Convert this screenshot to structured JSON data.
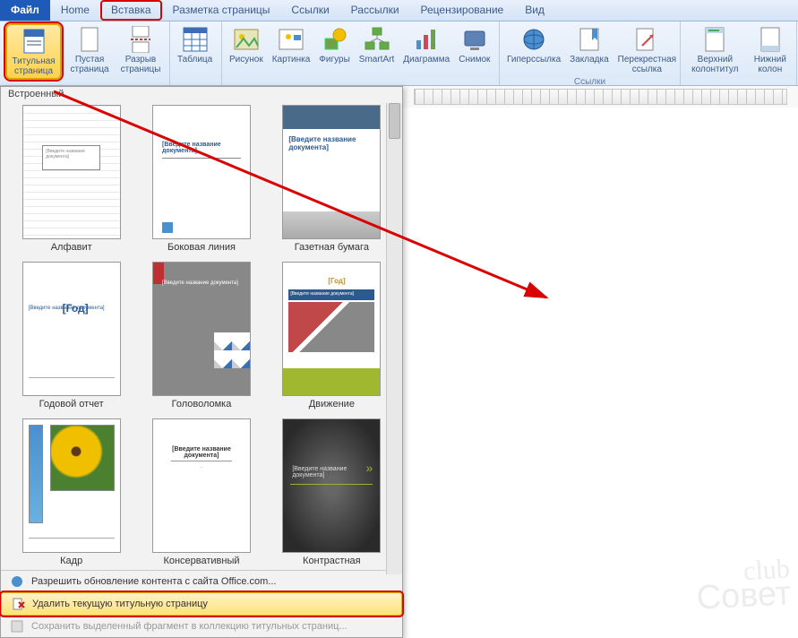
{
  "tabs": {
    "file": "Файл",
    "home": "Home",
    "insert": "Вставка",
    "layout": "Разметка страницы",
    "refs": "Ссылки",
    "mail": "Рассылки",
    "review": "Рецензирование",
    "view": "Вид"
  },
  "ribbon": {
    "coverpage": "Титульная страница",
    "blankpage": "Пустая страница",
    "pagebreak": "Разрыв страницы",
    "table": "Таблица",
    "picture": "Рисунок",
    "clipart": "Картинка",
    "shapes": "Фигуры",
    "smartart": "SmartArt",
    "chart": "Диаграмма",
    "screenshot": "Снимок",
    "hyperlink": "Гиперссылка",
    "bookmark": "Закладка",
    "crossref": "Перекрестная ссылка",
    "header": "Верхний колонтитул",
    "footer": "Нижний колон",
    "group_links": "Ссылки"
  },
  "gallery": {
    "header": "Встроенный",
    "items": [
      {
        "label": "Алфавит"
      },
      {
        "label": "Боковая линия"
      },
      {
        "label": "Газетная бумага"
      },
      {
        "label": "Годовой отчет"
      },
      {
        "label": "Головоломка"
      },
      {
        "label": "Движение"
      },
      {
        "label": "Кадр"
      },
      {
        "label": "Консервативный"
      },
      {
        "label": "Контрастная"
      }
    ],
    "placeholder_title": "[Введите название документа]",
    "placeholder_year": "[Год]",
    "footer": {
      "office": "Разрешить обновление контента с сайта Office.com...",
      "remove": "Удалить текущую титульную страницу",
      "save": "Сохранить выделенный фрагмент в коллекцию титульных страниц..."
    }
  },
  "watermark": "club Совет"
}
